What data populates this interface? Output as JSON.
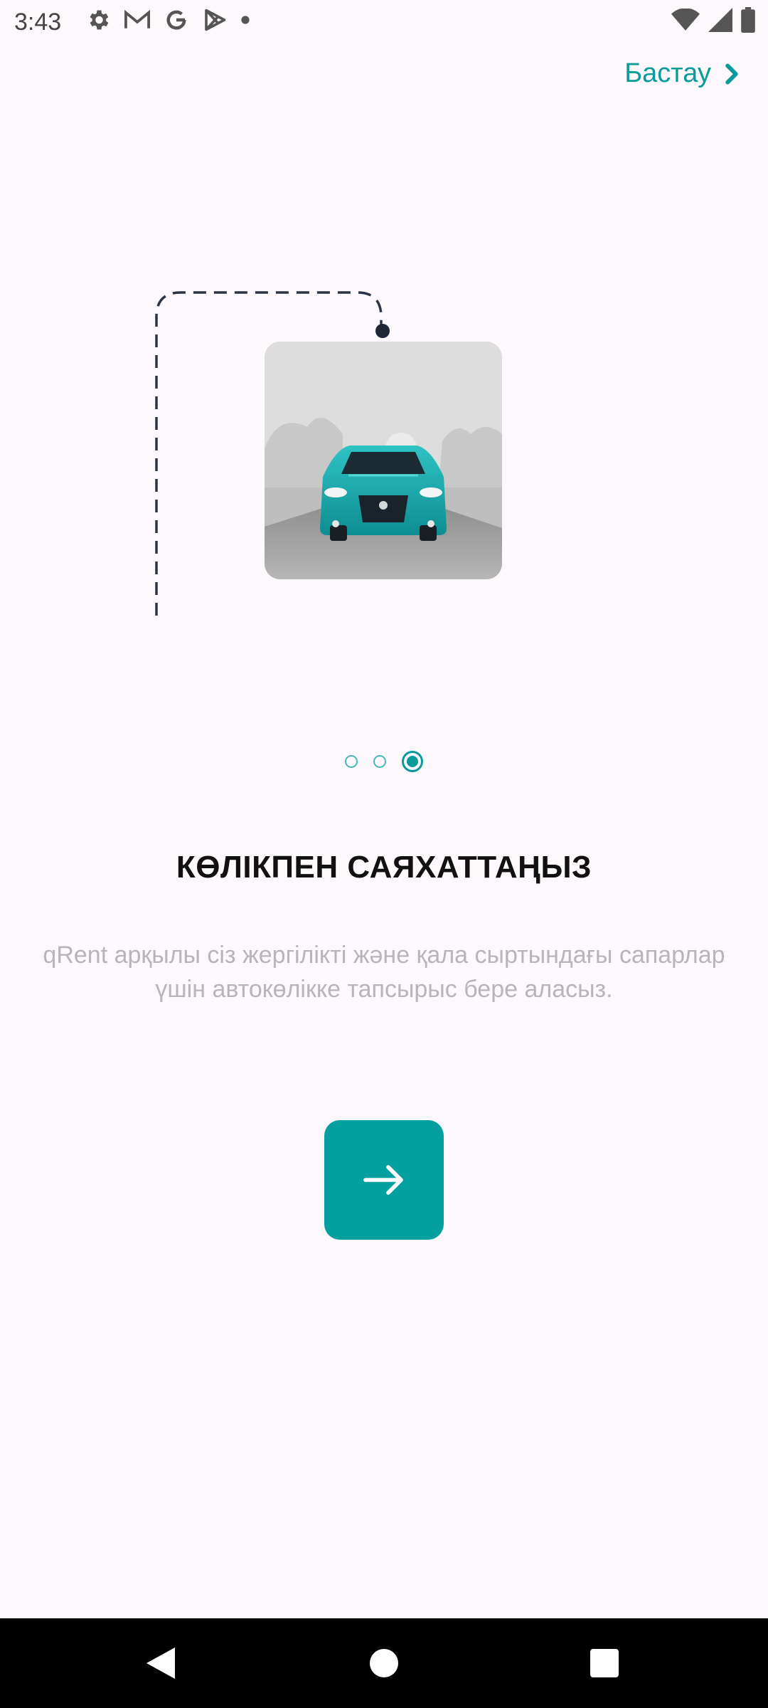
{
  "status_bar": {
    "time": "3:43",
    "icons_left": [
      "gear-icon",
      "gmail-icon",
      "google-icon",
      "play-store-icon",
      "notification-dot-icon"
    ],
    "icons_right": [
      "wifi-icon",
      "signal-icon",
      "battery-icon"
    ]
  },
  "header": {
    "skip_label": "Бастау",
    "skip_icon": "chevron-right-icon"
  },
  "illustration": {
    "subject": "car-illustration",
    "accent_color": "#1aa6a8"
  },
  "pager": {
    "total": 3,
    "active_index": 2
  },
  "content": {
    "title": "КӨЛІКПЕН САЯХАТТАҢЫЗ",
    "description": "qRent арқылы сіз жергілікті және қала сыртындағы сапарлар үшін автокөлікке тапсырыс бере аласыз."
  },
  "next_button": {
    "icon": "arrow-right-icon",
    "color": "#03a09f"
  },
  "nav_bar": {
    "buttons": [
      "back-icon",
      "home-icon",
      "recents-icon"
    ]
  },
  "colors": {
    "accent": "#0a9b9a",
    "background": "#fdf8fc",
    "text_secondary": "#b8b4b8"
  }
}
